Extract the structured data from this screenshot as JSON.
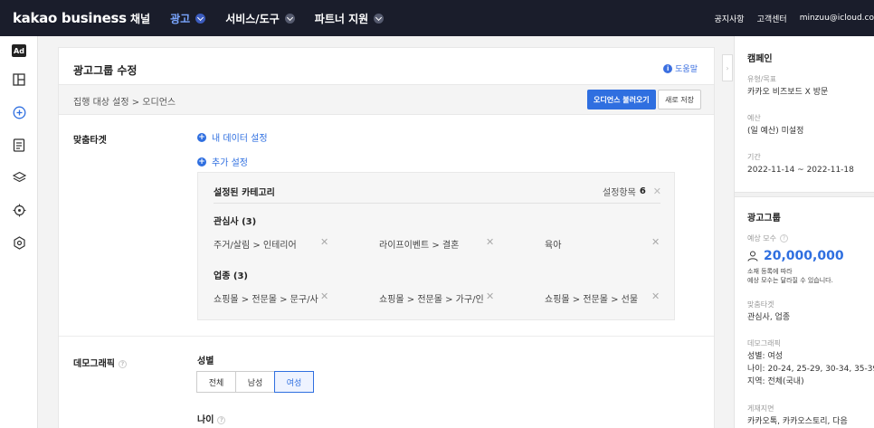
{
  "header": {
    "logo": "kakao business",
    "nav": [
      {
        "label": "채널"
      },
      {
        "label": "광고"
      },
      {
        "label": "서비스/도구"
      },
      {
        "label": "파트너 지원"
      }
    ],
    "right": [
      "공지사항",
      "고객센터",
      "minzuu@icloud.co"
    ]
  },
  "sidebar": {
    "ad_badge": "Ad",
    "icons": [
      "dashboard-icon",
      "add-circle-icon",
      "report-icon",
      "layers-icon",
      "target-icon",
      "settings-icon"
    ]
  },
  "card": {
    "title": "광고그룹 수정",
    "help": "도움말",
    "breadcrumb": "집행 대상 설정 > 오디언스",
    "load_audience_btn": "오디언스 불러오기",
    "save_new_btn": "새로 저장"
  },
  "targeting": {
    "label": "맞춤타겟",
    "my_data": "내 데이터 설정",
    "extra": "추가 설정",
    "box_title": "설정된 카테고리",
    "count_label": "설정항목",
    "count": "6",
    "interest_title": "관심사 (3)",
    "interests": [
      "주거/살림 > 인테리어",
      "라이프이벤트 > 결혼",
      "육아"
    ],
    "industry_title": "업종 (3)",
    "industries": [
      "쇼핑몰 > 전문몰 > 문구/사...",
      "쇼핑몰 > 전문몰 > 가구/인...",
      "쇼핑몰 > 전문몰 > 선물"
    ]
  },
  "demographic": {
    "label": "데모그래픽",
    "gender_label": "성별",
    "gender_options": [
      "전체",
      "남성",
      "여성"
    ],
    "gender_selected": "여성",
    "age_label": "나이"
  },
  "summary": {
    "campaign_head": "캠페인",
    "type_label": "유형/목표",
    "type_value": "카카오 비즈보드 X 방문",
    "budget_label": "예산",
    "budget_value": "(일 예산) 미설정",
    "period_label": "기간",
    "period_value": "2022-11-14 ~ 2022-11-18",
    "adgroup_head": "광고그룹",
    "pop_label": "예상 모수",
    "pop_value": "20,000,000",
    "pop_note1": "소재 등록에 따라",
    "pop_note2": "예상 모수는 달라질 수 있습니다.",
    "target_label": "맞춤타겟",
    "target_value": "관심사, 업종",
    "demo_label": "데모그래픽",
    "demo_gender": "성별: 여성",
    "demo_age": "나이: 20-24, 25-29, 30-34, 35-39",
    "demo_region": "지역: 전체(국내)",
    "placement_label": "게재지면",
    "placement_value": "카카오톡, 카카오스토리, 다음"
  },
  "colors": {
    "accent": "#2f6fe0",
    "topbar": "#1a1d2b"
  }
}
